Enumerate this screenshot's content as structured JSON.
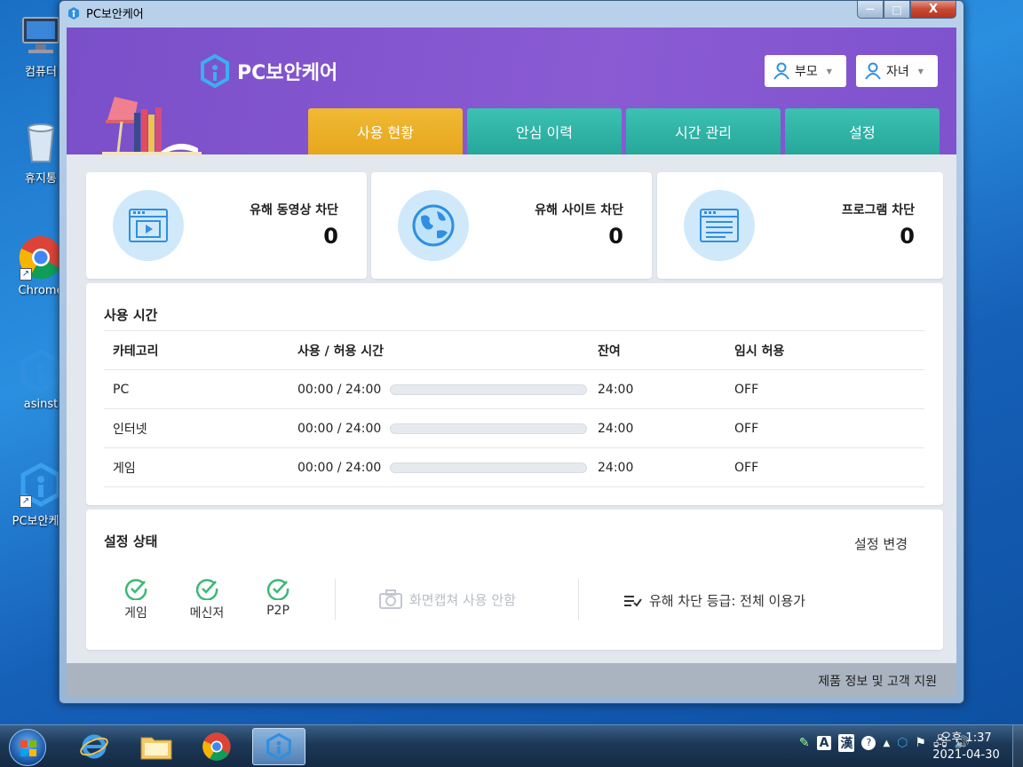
{
  "desktop": {
    "icons": [
      {
        "label": "컴퓨터"
      },
      {
        "label": "휴지통"
      },
      {
        "label": "Chrome"
      },
      {
        "label": "asinst"
      },
      {
        "label": "PC보안케어"
      }
    ]
  },
  "window": {
    "title": "PC보안케어",
    "controls": {
      "minimize": "—",
      "maximize": "□",
      "close": "X"
    }
  },
  "header": {
    "brand": "PC보안케어",
    "roles": [
      {
        "label": "부모"
      },
      {
        "label": "자녀"
      }
    ],
    "tabs": [
      {
        "label": "사용 현황",
        "active": true
      },
      {
        "label": "안심 이력",
        "active": false
      },
      {
        "label": "시간 관리",
        "active": false
      },
      {
        "label": "설정",
        "active": false
      }
    ]
  },
  "stats": [
    {
      "title": "유해 동영상 차단",
      "value": "0",
      "icon": "video-icon"
    },
    {
      "title": "유해 사이트 차단",
      "value": "0",
      "icon": "globe-icon"
    },
    {
      "title": "프로그램 차단",
      "value": "0",
      "icon": "program-window-icon"
    }
  ],
  "usage": {
    "title": "사용 시간",
    "columns": [
      "카테고리",
      "사용 / 허용 시간",
      "잔여",
      "임시 허용"
    ],
    "rows": [
      {
        "category": "PC",
        "time": "00:00 / 24:00",
        "progress": 0,
        "remaining": "24:00",
        "temp": "OFF"
      },
      {
        "category": "인터넷",
        "time": "00:00 / 24:00",
        "progress": 0,
        "remaining": "24:00",
        "temp": "OFF"
      },
      {
        "category": "게임",
        "time": "00:00 / 24:00",
        "progress": 0,
        "remaining": "24:00",
        "temp": "OFF"
      }
    ]
  },
  "settings": {
    "title": "설정 상태",
    "change_label": "설정 변경",
    "checks": [
      {
        "label": "게임"
      },
      {
        "label": "메신저"
      },
      {
        "label": "P2P"
      }
    ],
    "capture_label": "화면캡쳐 사용 안함",
    "grade_label": "유해 차단 등급: 전체 이용가"
  },
  "footer": {
    "support": "제품 정보 및 고객 지원"
  },
  "taskbar": {
    "clock_time": "오후 1:37",
    "clock_date": "2021-04-30",
    "ime_a": "A",
    "ime_han": "漢"
  },
  "colors": {
    "header": "#8a5bd3",
    "tab": "#2db3a5",
    "tab_active": "#eeb22c",
    "check": "#3cb878",
    "stat_circle": "#cfe9fb"
  }
}
